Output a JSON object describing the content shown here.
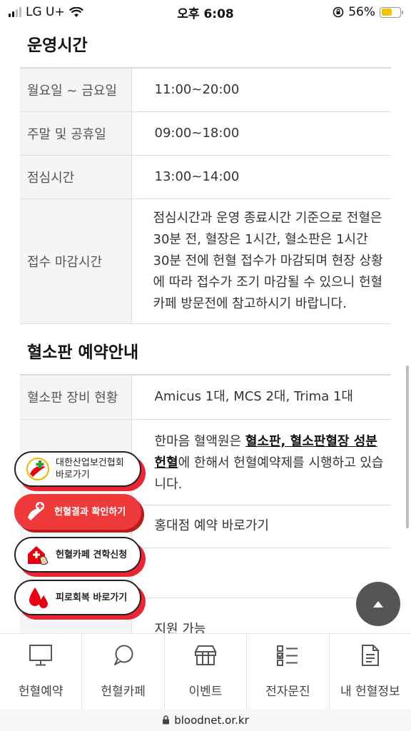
{
  "status_bar": {
    "carrier": "LG U+",
    "time": "오후 6:08",
    "battery_percent": "56%",
    "battery_level": 0.56
  },
  "section1": {
    "title": "운영시간",
    "rows": [
      {
        "label": "월요일 ~ 금요일",
        "value": "11:00~20:00"
      },
      {
        "label": "주말 및 공휴일",
        "value": "09:00~18:00"
      },
      {
        "label": "점심시간",
        "value": "13:00~14:00"
      },
      {
        "label": "접수 마감시간",
        "value": "점심시간과 운영 종료시간 기준으로 전혈은 30분 전, 혈장은 1시간, 혈소판은 1시간 30분 전에 헌혈 접수가 마감되며 현장 상황에 따라 접수가 조기 마감될 수 있으니 헌혈카페 방문전에 참고하시기 바랍니다."
      }
    ]
  },
  "section2": {
    "title": "혈소판 예약안내",
    "equipment_label": "혈소판 장비 현황",
    "equipment_value": "Amicus 1대, MCS 2대, Trima 1대",
    "desc_prefix": "한마음 혈액원은 ",
    "desc_bold": "혈소판, 혈소판혈장 성분헌혈",
    "desc_suffix": "에 한해서 헌혈예약제를 시행하고 있습니다.",
    "reserve_link": "홍대점 예약 바로가기",
    "partial_row_value": "지원 가능"
  },
  "floating_buttons": [
    {
      "icon": "health-association-logo-icon",
      "label_line1": "대한산업보건협회",
      "label_line2": "바로가기"
    },
    {
      "icon": "blood-cross-icon",
      "label_line1": "헌혈결과 확인하기"
    },
    {
      "icon": "house-hand-icon",
      "label_line1": "헌혈카페 견학신청"
    },
    {
      "icon": "blood-drops-icon",
      "label_line1": "피로회복 바로가기"
    }
  ],
  "bottom_nav": [
    {
      "icon": "monitor-icon",
      "label": "헌혈예약"
    },
    {
      "icon": "speech-bubble-icon",
      "label": "헌혈카페"
    },
    {
      "icon": "gift-box-icon",
      "label": "이벤트"
    },
    {
      "icon": "checklist-icon",
      "label": "전자문진"
    },
    {
      "icon": "document-icon",
      "label": "내 헌혈정보"
    }
  ],
  "url_bar": {
    "url": "bloodnet.or.kr"
  },
  "colors": {
    "accent_red": "#e60012",
    "button_red": "#ee3a3a"
  }
}
